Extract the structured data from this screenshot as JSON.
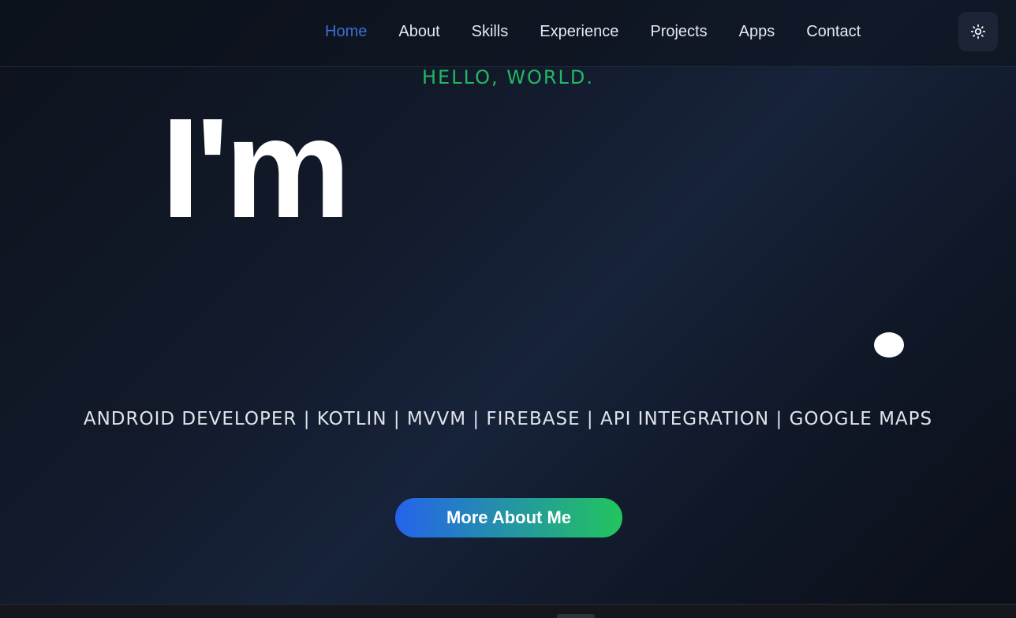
{
  "nav": {
    "items": [
      {
        "label": "Home",
        "active": true
      },
      {
        "label": "About",
        "active": false
      },
      {
        "label": "Skills",
        "active": false
      },
      {
        "label": "Experience",
        "active": false
      },
      {
        "label": "Projects",
        "active": false
      },
      {
        "label": "Apps",
        "active": false
      },
      {
        "label": "Contact",
        "active": false
      }
    ],
    "theme_toggle_icon": "sun-icon"
  },
  "hero": {
    "greeting": "HELLO, WORLD.",
    "title": "I'm",
    "roles": "ANDROID DEVELOPER | KOTLIN | MVVM | FIREBASE | API INTEGRATION | GOOGLE MAPS",
    "cta_label": "More About Me"
  },
  "colors": {
    "active_link": "#3b6fd6",
    "greeting": "#22b866",
    "cta_gradient_start": "#2563eb",
    "cta_gradient_end": "#22c55e",
    "background": "#121a2a"
  }
}
